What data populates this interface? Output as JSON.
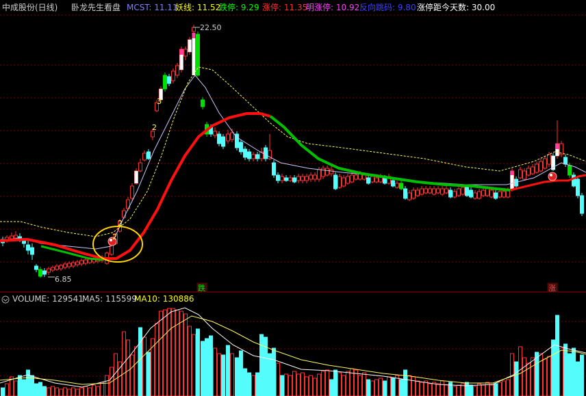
{
  "header": {
    "stock": "中成股份(日线)",
    "indicator": "卧龙先生看盘",
    "mcst": "MCST: 11.11",
    "yao": "妖线: 11.52",
    "die": "跌停: 9.29",
    "zhang": "涨停: 11.35",
    "ming": "明涨停: 10.92",
    "fan": "反向跳码: 9.80",
    "days": "涨停距今天数: 30.00"
  },
  "volume_header": {
    "volume": "VOLUME: 129541",
    "ma5": "MA5: 115599",
    "ma10": "MA10: 130886"
  },
  "annotations": {
    "high_label": "22.50",
    "low_label": "6.85",
    "die_marker": "跌",
    "zhang_marker": "涨",
    "num_a": "2",
    "num_b": "2",
    "num_c": "3",
    "num_d": "2"
  },
  "colors": {
    "up": "#ff3232",
    "down": "#54fcfc",
    "green_bar": "#00e000",
    "ma_white": "#c8c8ff",
    "ma_yellow": "#ffff60",
    "main_line_red": "#ff1010",
    "main_line_green": "#00c000",
    "grid": "#800000",
    "circle": "#ffd700"
  }
}
